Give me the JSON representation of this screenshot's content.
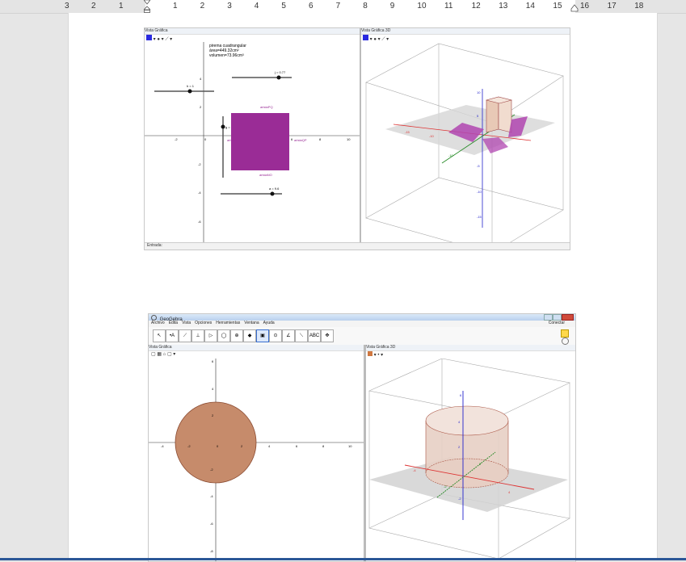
{
  "ruler": {
    "left_numbers": [
      "3",
      "2",
      "1"
    ],
    "right_numbers": [
      "1",
      "2",
      "3",
      "4",
      "5",
      "6",
      "7",
      "8",
      "9",
      "10",
      "11",
      "12",
      "13",
      "14",
      "15",
      "16",
      "17",
      "18"
    ]
  },
  "shot1": {
    "view_title_left": "Vista Gráfica",
    "view_title_right": "Vista Gráfica 3D",
    "info_lines": [
      "pirema cuadrangular",
      "área=449.32cm²",
      "volumen=73.96cm³"
    ],
    "slider_h": "h = 1",
    "slider_j": "j = 0.77",
    "slider_a": "a = 9.6",
    "slider_g": "g = 3",
    "edge_labels": [
      "aristaPQ",
      "aristaQP",
      "aristaNO",
      "aristaS"
    ],
    "x_ticks": [
      "-2",
      "0",
      "2",
      "4",
      "6",
      "8",
      "10"
    ],
    "y_ticks": [
      "4",
      "2",
      "-2",
      "-4",
      "-6"
    ],
    "axis3d_ticks": [
      "10",
      "5",
      "-5",
      "-10",
      "-15",
      "-15",
      "-10",
      "-10"
    ],
    "input_label": "Entrada:",
    "colors": {
      "square": "#9a2c96",
      "prism": "#b045b0"
    }
  },
  "shot2": {
    "app_title": "GeoGebra",
    "menu": [
      "Archivo",
      "Edita",
      "Vista",
      "Opciones",
      "Herramientas",
      "Ventana",
      "Ayuda"
    ],
    "connect": "Conectar",
    "tool_abc": "ABC",
    "view_title_left": "Vista Gráfica",
    "view_title_right": "Vista Gráfica 3D",
    "x_ticks": [
      "-4",
      "-2",
      "0",
      "2",
      "4",
      "6",
      "8",
      "10"
    ],
    "y_ticks": [
      "6",
      "4",
      "2",
      "-2",
      "-4",
      "-6",
      "-8"
    ],
    "axis3d_ticks": [
      "6",
      "4",
      "2",
      "-2",
      "4",
      "-4",
      "2",
      "-2"
    ],
    "colors": {
      "circle": "#c68b6b",
      "cylinder": "#e7cfc4"
    }
  }
}
